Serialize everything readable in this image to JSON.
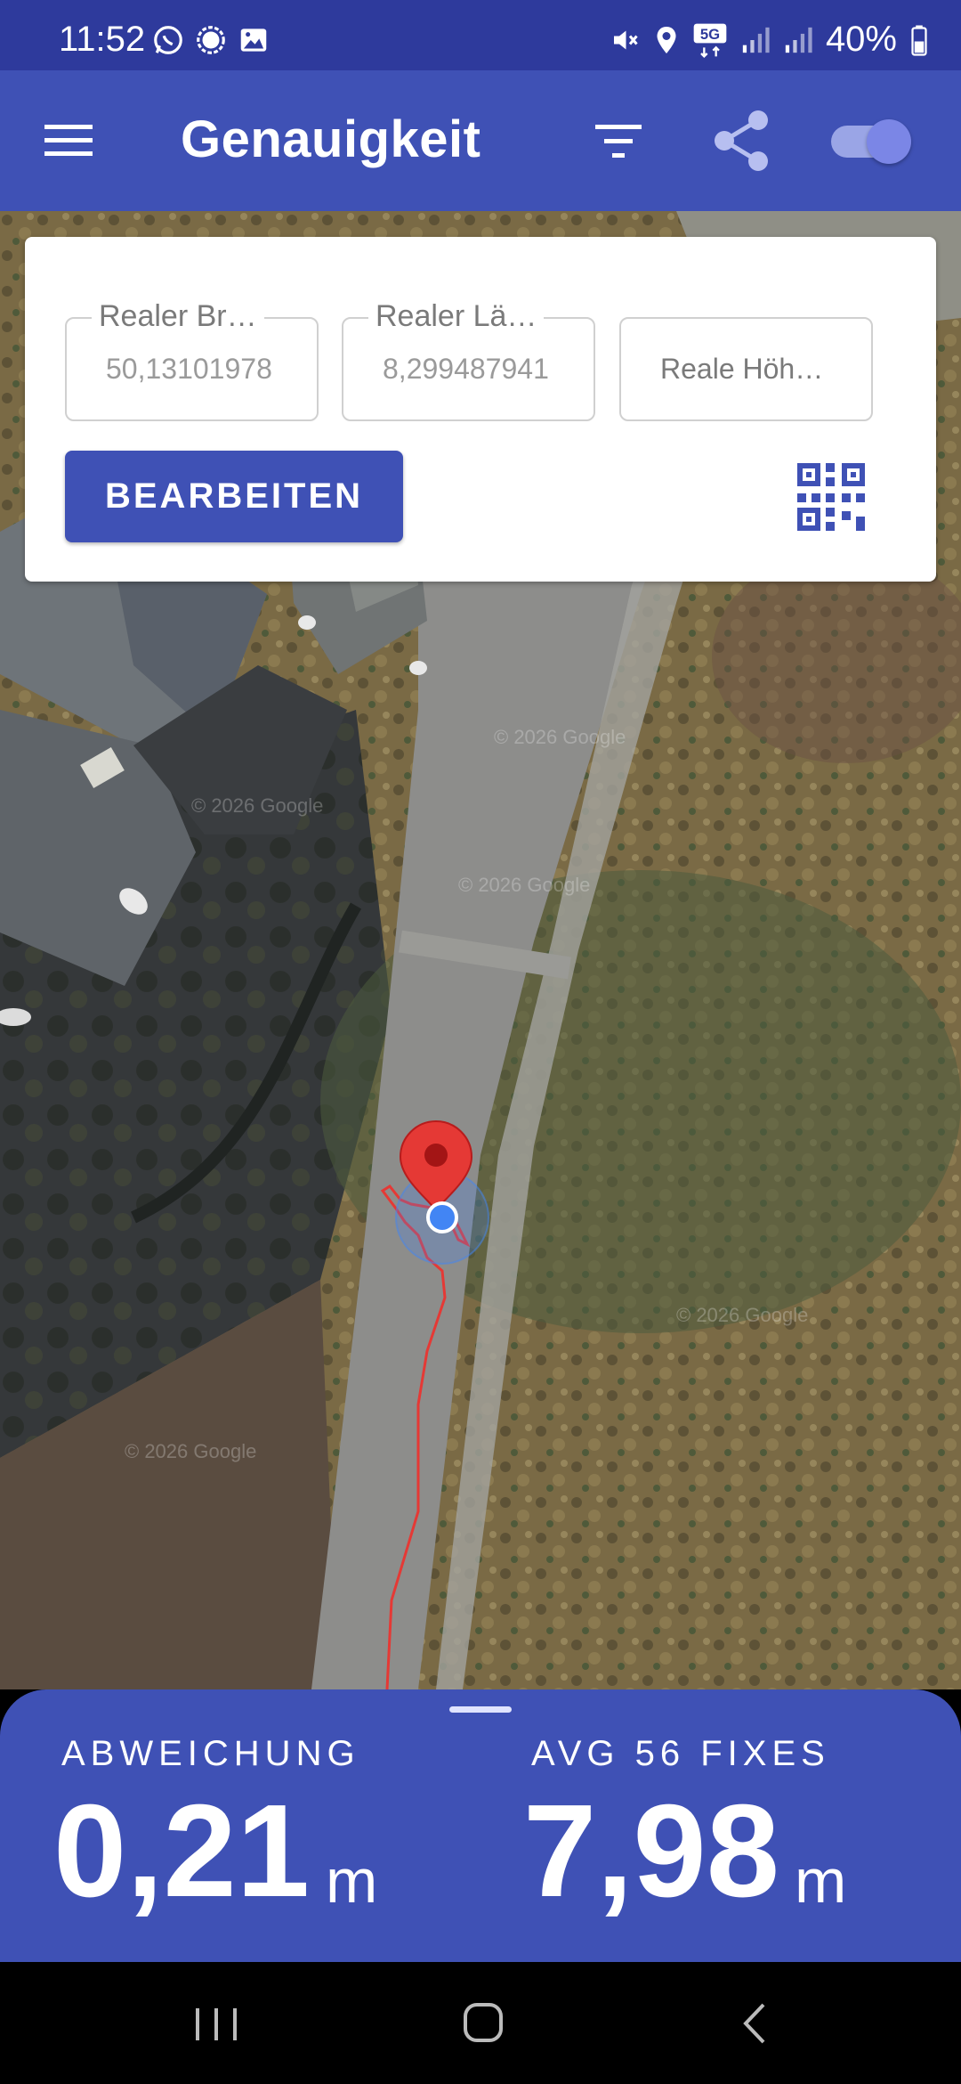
{
  "status": {
    "time": "11:52",
    "battery": "40%",
    "network": "5G",
    "icons": [
      "whatsapp-icon",
      "signal-app-icon",
      "gallery-icon",
      "mute-icon",
      "location-icon",
      "5g-icon",
      "signal-icon",
      "signal-icon",
      "battery-icon"
    ]
  },
  "appbar": {
    "title": "Genauigkeit",
    "toggle_on": true
  },
  "form": {
    "lat_label": "Realer Br…",
    "lat_value": "50,13101978",
    "lon_label": "Realer Lä…",
    "lon_value": "8,299487941",
    "alt_placeholder": "Reale Höh…",
    "edit_button": "BEARBEITEN"
  },
  "map": {
    "watermark": "© 2026 Google"
  },
  "bottom": {
    "deviation_label": "ABWEICHUNG",
    "deviation_value": "0,21",
    "deviation_unit": "m",
    "avg_label": "AVG 56 FIXES",
    "avg_value": "7,98",
    "avg_unit": "m"
  },
  "colors": {
    "primary": "#3f51b5",
    "status_bar": "#2e3a9c",
    "marker": "#e53935",
    "location_dot": "#4285f4"
  }
}
